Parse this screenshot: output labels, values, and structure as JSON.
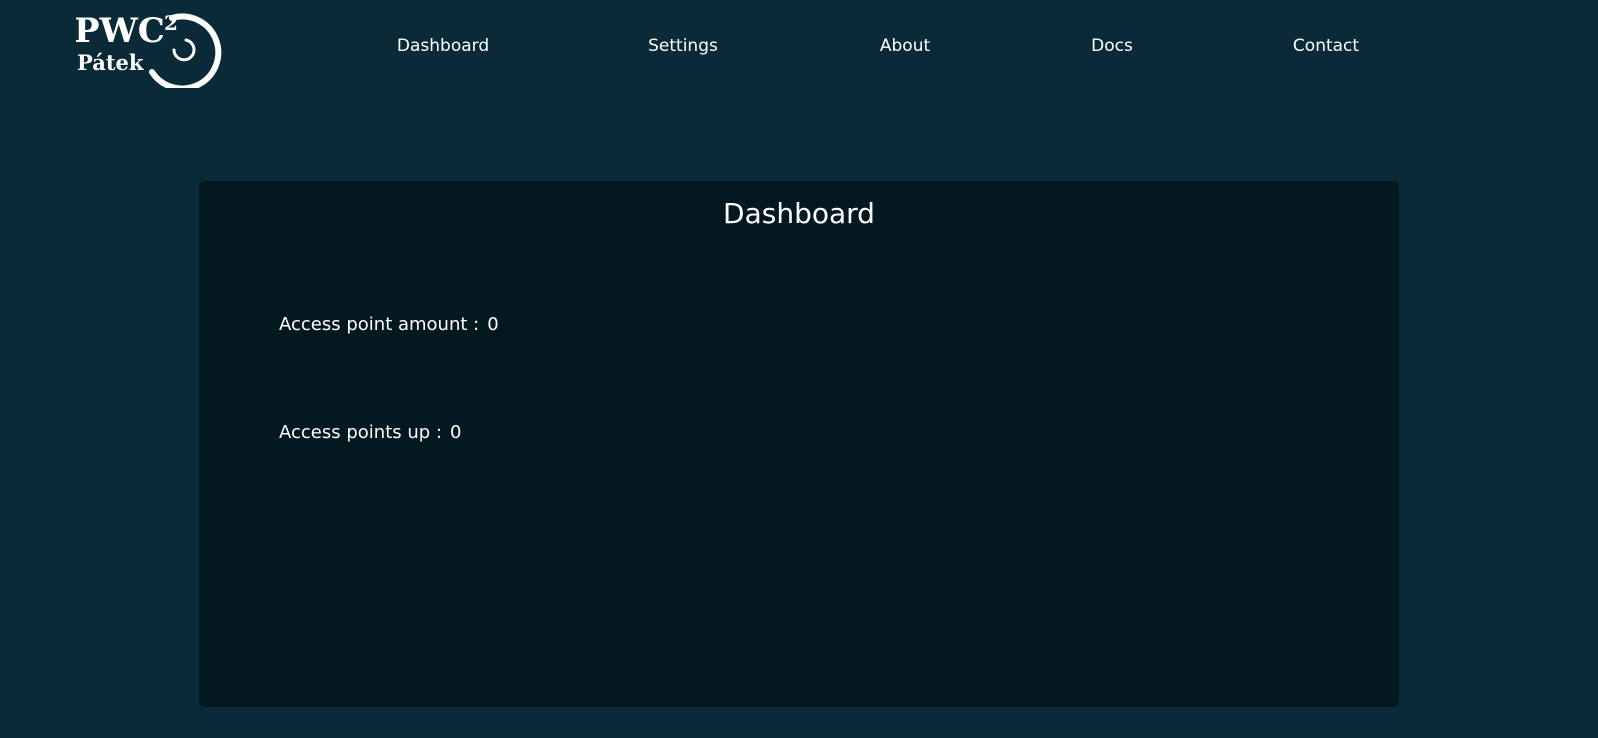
{
  "logo": {
    "line1": "PWC",
    "superscript": "2",
    "line2": "Pátek",
    "icon": "pwc-patek-logo-icon"
  },
  "nav": {
    "items": [
      {
        "label": "Dashboard"
      },
      {
        "label": "Settings"
      },
      {
        "label": "About"
      },
      {
        "label": "Docs"
      },
      {
        "label": "Contact"
      }
    ]
  },
  "dashboard": {
    "title": "Dashboard",
    "stats": [
      {
        "label": "Access point amount :",
        "value": "0"
      },
      {
        "label": "Access points up :",
        "value": "0"
      }
    ]
  },
  "colors": {
    "page_background": "#0a2a38",
    "card_background": "#041820",
    "text": "#ffffff"
  }
}
